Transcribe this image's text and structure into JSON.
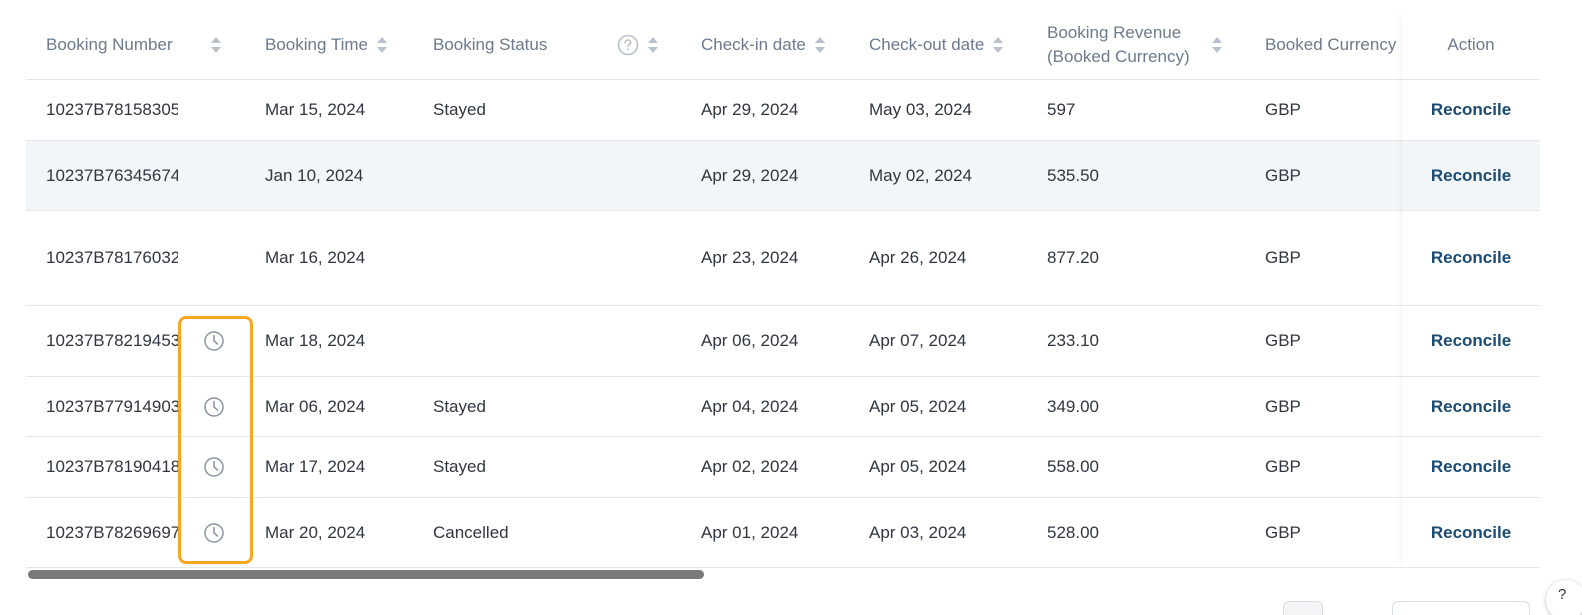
{
  "header": {
    "booking_number": "Booking Number",
    "booking_time": "Booking Time",
    "booking_status": "Booking Status",
    "checkin": "Check-in date",
    "checkout": "Check-out date",
    "revenue_line1": "Booking Revenue",
    "revenue_line2": "(Booked Currency)",
    "currency": "Booked Currency",
    "action": "Action"
  },
  "rows": [
    {
      "num": "10237B78158305",
      "time": "Mar 15, 2024",
      "status": "Stayed",
      "checkin": "Apr 29, 2024",
      "checkout": "May 03, 2024",
      "revenue": "597",
      "currency": "GBP",
      "action": "Reconcile"
    },
    {
      "num": "10237B76345674",
      "time": "Jan 10, 2024",
      "status": "",
      "checkin": "Apr 29, 2024",
      "checkout": "May 02, 2024",
      "revenue": "535.50",
      "currency": "GBP",
      "action": "Reconcile"
    },
    {
      "num": "10237B78176032",
      "time": "Mar 16, 2024",
      "status": "",
      "checkin": "Apr 23, 2024",
      "checkout": "Apr 26, 2024",
      "revenue": "877.20",
      "currency": "GBP",
      "action": "Reconcile"
    },
    {
      "num": "10237B78219453",
      "time": "Mar 18, 2024",
      "status": "",
      "checkin": "Apr 06, 2024",
      "checkout": "Apr 07, 2024",
      "revenue": "233.10",
      "currency": "GBP",
      "action": "Reconcile"
    },
    {
      "num": "10237B77914903",
      "time": "Mar 06, 2024",
      "status": "Stayed",
      "checkin": "Apr 04, 2024",
      "checkout": "Apr 05, 2024",
      "revenue": "349.00",
      "currency": "GBP",
      "action": "Reconcile"
    },
    {
      "num": "10237B78190418",
      "time": "Mar 17, 2024",
      "status": "Stayed",
      "checkin": "Apr 02, 2024",
      "checkout": "Apr 05, 2024",
      "revenue": "558.00",
      "currency": "GBP",
      "action": "Reconcile"
    },
    {
      "num": "10237B78269697",
      "time": "Mar 20, 2024",
      "status": "Cancelled",
      "checkin": "Apr 01, 2024",
      "checkout": "Apr 03, 2024",
      "revenue": "528.00",
      "currency": "GBP",
      "action": "Reconcile"
    }
  ],
  "icons": {
    "sort": "sort-icon",
    "help": "help-circle-icon",
    "clock": "clock-icon"
  },
  "floating_help_glyph": "?",
  "colors": {
    "header_text": "#6c7a8c",
    "body_text": "#2f3640",
    "action_link": "#1b4b72",
    "row_highlight": "#f3f6f9",
    "highlight_box": "#f5a623",
    "scrollbar_thumb": "#7a7a7a"
  }
}
